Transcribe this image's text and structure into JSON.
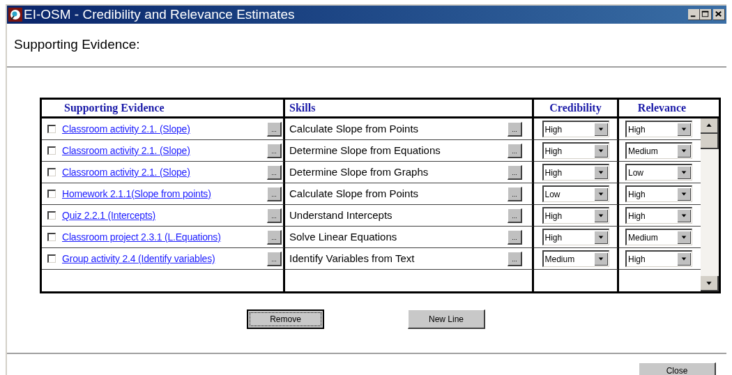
{
  "window": {
    "title": "EI-OSM - Credibility and Relevance Estimates"
  },
  "section_title": "Supporting Evidence:",
  "table": {
    "columns": [
      "Supporting Evidence",
      "Skills",
      "Credibility",
      "Relevance"
    ],
    "rows": [
      {
        "checked": false,
        "evidence": "Classroom activity 2.1. (Slope)",
        "evidence_button": "...",
        "skill": "Calculate Slope from Points",
        "skill_button": "...",
        "credibility": "High",
        "relevance": "High"
      },
      {
        "checked": false,
        "evidence": "Classroom activity 2.1. (Slope)",
        "evidence_button": "...",
        "skill": "Determine Slope from Equations",
        "skill_button": "...",
        "credibility": "High",
        "relevance": "Medium"
      },
      {
        "checked": false,
        "evidence": "Classroom activity 2.1. (Slope)",
        "evidence_button": "...",
        "skill": "Determine Slope from Graphs",
        "skill_button": "...",
        "credibility": "High",
        "relevance": "Low"
      },
      {
        "checked": false,
        "evidence": "Homework 2.1.1(Slope from points)",
        "evidence_button": "...",
        "skill": "Calculate Slope from Points",
        "skill_button": "...",
        "credibility": "Low",
        "relevance": "High"
      },
      {
        "checked": false,
        "evidence": "Quiz 2.2.1 (Intercepts)",
        "evidence_button": "...",
        "skill": "Understand Intercepts",
        "skill_button": "...",
        "credibility": "High",
        "relevance": "High"
      },
      {
        "checked": false,
        "evidence": "Classroom project 2.3.1 (L.Equations)",
        "evidence_button": "...",
        "skill": "Solve Linear Equations",
        "skill_button": "...",
        "credibility": "High",
        "relevance": "Medium"
      },
      {
        "checked": false,
        "evidence": "Group activity 2.4 (Identify variables)",
        "evidence_button": "...",
        "skill": "Identify Variables from Text",
        "skill_button": "...",
        "credibility": "Medium",
        "relevance": "High"
      }
    ]
  },
  "buttons": [
    {
      "label": "Remove",
      "focused": true
    },
    {
      "label": "New Line",
      "focused": false
    }
  ],
  "close_button": "Close"
}
